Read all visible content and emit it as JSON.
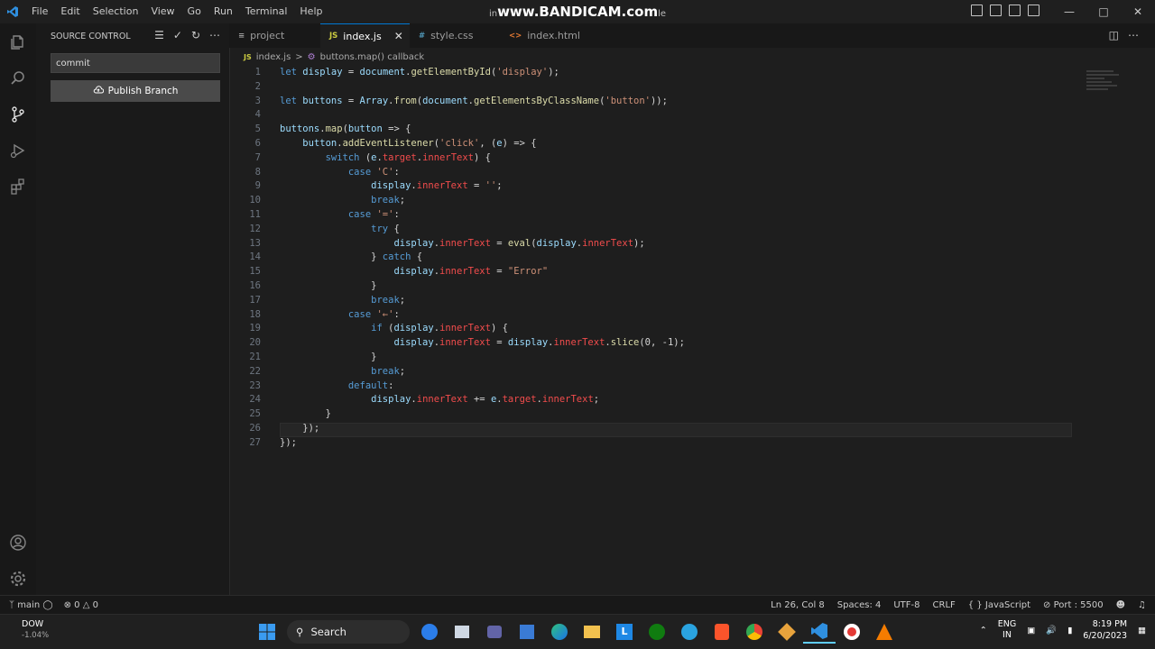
{
  "titlebar": {
    "menu": [
      "File",
      "Edit",
      "Selection",
      "View",
      "Go",
      "Run",
      "Terminal",
      "Help"
    ],
    "overlay_left": "in",
    "overlay_main": "www.BANDICAM.com",
    "overlay_right": "le"
  },
  "sidebar": {
    "title": "SOURCE CONTROL",
    "commit_value": "commit",
    "publish_label": "Publish Branch"
  },
  "tabs": [
    {
      "icon": "",
      "label": "project"
    },
    {
      "icon": "JS",
      "label": "index.js"
    },
    {
      "icon": "",
      "label": "style.css"
    },
    {
      "icon": "",
      "label": "index.html"
    }
  ],
  "breadcrumb": {
    "file_icon": "JS",
    "file": "index.js",
    "separator": ">",
    "symbol": "buttons.map() callback"
  },
  "code": [
    {
      "n": "1",
      "t": "let display = document.getElementById('display');"
    },
    {
      "n": "2",
      "t": ""
    },
    {
      "n": "3",
      "t": "let buttons = Array.from(document.getElementsByClassName('button'));"
    },
    {
      "n": "4",
      "t": ""
    },
    {
      "n": "5",
      "t": "buttons.map(button => {"
    },
    {
      "n": "6",
      "t": "    button.addEventListener('click', (e) => {"
    },
    {
      "n": "7",
      "t": "        switch (e.target.innerText) {"
    },
    {
      "n": "8",
      "t": "            case 'C':"
    },
    {
      "n": "9",
      "t": "                display.innerText = '';"
    },
    {
      "n": "10",
      "t": "                break;"
    },
    {
      "n": "11",
      "t": "            case '=':"
    },
    {
      "n": "12",
      "t": "                try {"
    },
    {
      "n": "13",
      "t": "                    display.innerText = eval(display.innerText);"
    },
    {
      "n": "14",
      "t": "                } catch {"
    },
    {
      "n": "15",
      "t": "                    display.innerText = \"Error\""
    },
    {
      "n": "16",
      "t": "                }"
    },
    {
      "n": "17",
      "t": "                break;"
    },
    {
      "n": "18",
      "t": "            case '←':"
    },
    {
      "n": "19",
      "t": "                if (display.innerText) {"
    },
    {
      "n": "20",
      "t": "                    display.innerText = display.innerText.slice(0, -1);"
    },
    {
      "n": "21",
      "t": "                }"
    },
    {
      "n": "22",
      "t": "                break;"
    },
    {
      "n": "23",
      "t": "            default:"
    },
    {
      "n": "24",
      "t": "                display.innerText += e.target.innerText;"
    },
    {
      "n": "25",
      "t": "        }"
    },
    {
      "n": "26",
      "t": "    });"
    },
    {
      "n": "27",
      "t": "});"
    }
  ],
  "status": {
    "branch": "main",
    "errors": "0",
    "warnings": "0",
    "position": "Ln 26, Col 8",
    "spaces": "Spaces: 4",
    "encoding": "UTF-8",
    "eol": "CRLF",
    "language": "JavaScript",
    "port": "Port : 5500"
  },
  "taskbar": {
    "weather_title": "DOW",
    "weather_sub": "-1.04%",
    "search_label": "Search",
    "lang_top": "ENG",
    "lang_bottom": "IN",
    "time": "8:19 PM",
    "date": "6/20/2023"
  },
  "colors": {
    "accent": "#0078d4",
    "keyword": "#569cd6",
    "string": "#ce9178",
    "function": "#dcdcaa",
    "variable": "#9cdcfe",
    "property": "#f14c4c"
  }
}
